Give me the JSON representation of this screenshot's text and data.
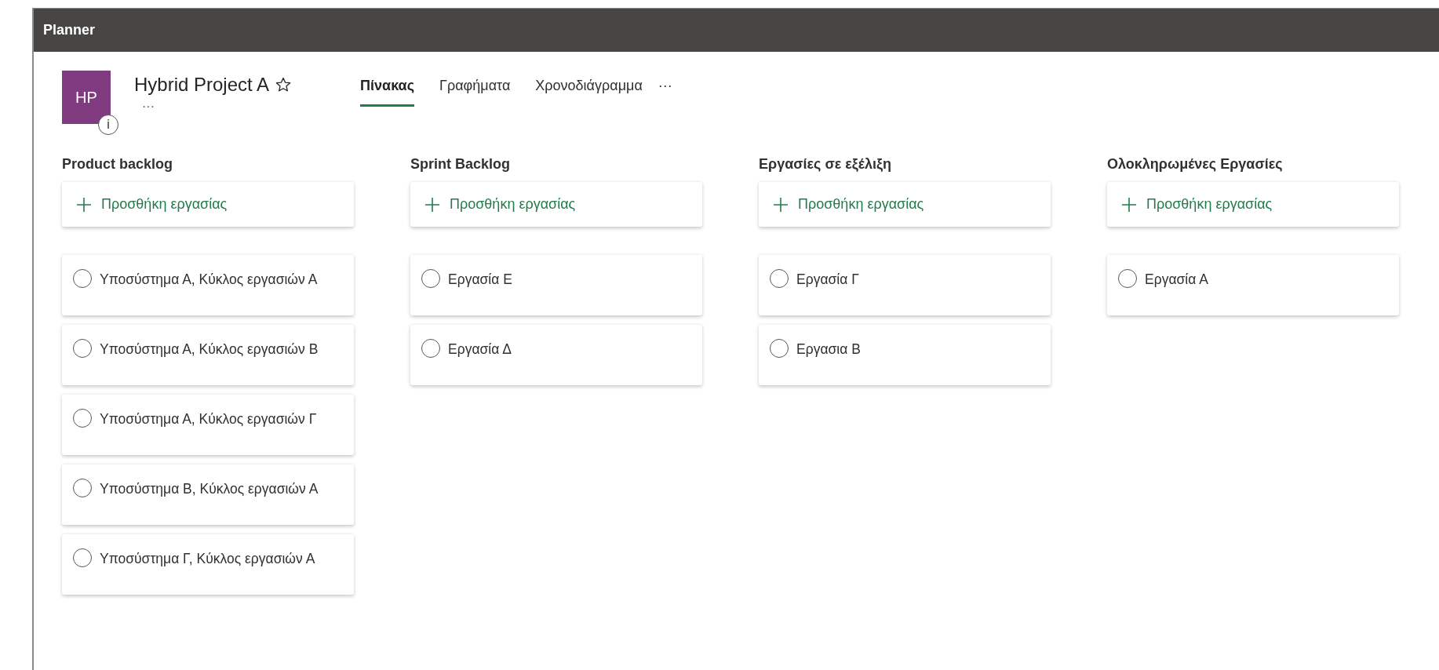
{
  "app_bar": {
    "title": "Planner"
  },
  "plan": {
    "initials": "HP",
    "name": "Hybrid Project A",
    "favorite": false,
    "info": "i",
    "more": "···"
  },
  "tabs": [
    {
      "label": "Πίνακας",
      "selected": true
    },
    {
      "label": "Γραφήματα",
      "selected": false
    },
    {
      "label": "Χρονοδιάγραμμα",
      "selected": false
    }
  ],
  "tabs_more": "···",
  "buckets": [
    {
      "title": "Product backlog",
      "add_label": "Προσθήκη εργασίας",
      "tasks": [
        {
          "title": "Υποσύστημα Α, Κύκλος εργασιών Α",
          "completed": false
        },
        {
          "title": "Υποσύστημα Α, Κύκλος εργασιών Β",
          "completed": false
        },
        {
          "title": "Υποσύστημα Α, Κύκλος εργασιών Γ",
          "completed": false
        },
        {
          "title": "Υποσύστημα Β, Κύκλος εργασιών Α",
          "completed": false
        },
        {
          "title": "Υποσύστημα Γ, Κύκλος εργασιών Α",
          "completed": false
        }
      ]
    },
    {
      "title": "Sprint Backlog",
      "add_label": "Προσθήκη εργασίας",
      "tasks": [
        {
          "title": "Εργασία Ε",
          "completed": false
        },
        {
          "title": "Εργασία Δ",
          "completed": false
        }
      ]
    },
    {
      "title": "Εργασίες σε εξέλιξη",
      "add_label": "Προσθήκη εργασίας",
      "tasks": [
        {
          "title": "Εργασία Γ",
          "completed": false
        },
        {
          "title": "Εργασια Β",
          "completed": false
        }
      ]
    },
    {
      "title": "Ολοκληρωμένες Εργασίες",
      "add_label": "Προσθήκη εργασίας",
      "tasks": [
        {
          "title": "Εργασία Α",
          "completed": false
        }
      ]
    }
  ]
}
